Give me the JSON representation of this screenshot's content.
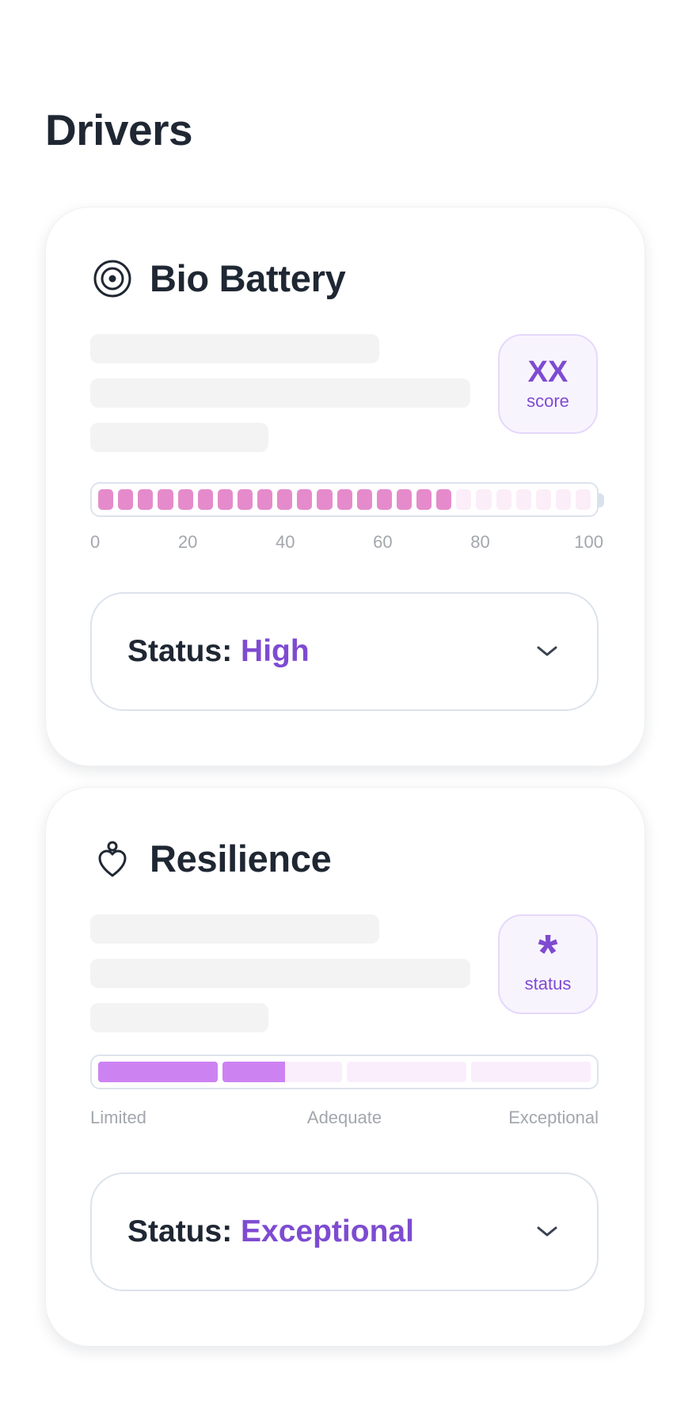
{
  "page": {
    "title": "Drivers"
  },
  "colors": {
    "accent": "#7e4bd1",
    "bar_pink": "#e58bcb",
    "bar_purple": "#cd82f2",
    "text_dark": "#1f2733"
  },
  "bio_battery": {
    "title": "Bio Battery",
    "icon": "target-icon",
    "score_chip": {
      "value": "XX",
      "label": "score"
    },
    "level_percent": 72,
    "axis_ticks": [
      "0",
      "20",
      "40",
      "60",
      "80",
      "100"
    ],
    "status": {
      "prefix": "Status:",
      "value": "High"
    }
  },
  "resilience": {
    "title": "Resilience",
    "icon": "heart-drop-icon",
    "score_chip": {
      "value": "*",
      "label": "status"
    },
    "level_fraction": 0.38,
    "scale_labels": [
      "Limited",
      "Adequate",
      "Exceptional"
    ],
    "status": {
      "prefix": "Status:",
      "value": "Exceptional"
    }
  }
}
